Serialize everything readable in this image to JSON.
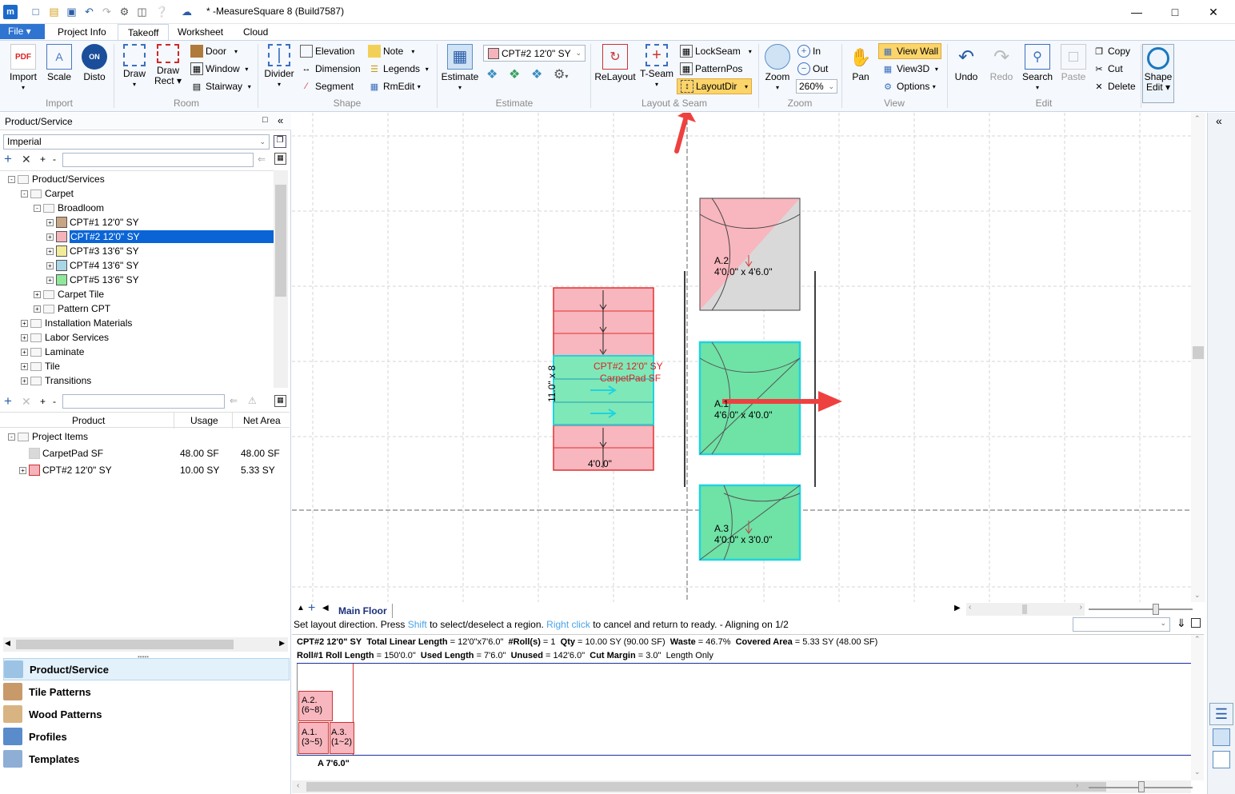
{
  "title_bar": {
    "title": "* -MeasureSquare 8 (Build7587)",
    "logo": "m"
  },
  "tabs": {
    "file": "File",
    "items": [
      "Project Info",
      "Takeoff",
      "Worksheet",
      "Cloud"
    ],
    "active": "Takeoff"
  },
  "ribbon": {
    "import_group": {
      "label": "Import",
      "buttons": [
        "Import",
        "Scale",
        "Disto"
      ]
    },
    "room_group": {
      "label": "Room",
      "draw": "Draw",
      "draw_rect_1": "Draw",
      "draw_rect_2": "Rect",
      "door": "Door",
      "window": "Window",
      "stairway": "Stairway"
    },
    "shape_group": {
      "label": "Shape",
      "divider": "Divider",
      "elevation": "Elevation",
      "dimension": "Dimension",
      "segment": "Segment",
      "note": "Note",
      "legends": "Legends",
      "rmedit": "RmEdit"
    },
    "estimate_group": {
      "label": "Estimate",
      "estimate": "Estimate",
      "product_select": "CPT#2 12'0\" SY"
    },
    "layout_group": {
      "label": "Layout & Seam",
      "relayout": "ReLayout",
      "tseam": "T-Seam",
      "lockseam": "LockSeam",
      "patternpos": "PatternPos",
      "layoutdir": "LayoutDir"
    },
    "zoom_group": {
      "label": "Zoom",
      "zoom": "Zoom",
      "in": "In",
      "out": "Out",
      "level": "260%"
    },
    "view_group": {
      "label": "View",
      "pan": "Pan",
      "view_wall": "View Wall",
      "view3d": "View3D",
      "options": "Options"
    },
    "edit_group": {
      "label": "Edit",
      "undo": "Undo",
      "redo": "Redo",
      "search": "Search",
      "paste": "Paste",
      "copy": "Copy",
      "cut": "Cut",
      "delete": "Delete"
    },
    "shape_edit": {
      "line1": "Shape",
      "line2": "Edit"
    }
  },
  "left_panel": {
    "title": "Product/Service",
    "unit_select": "Imperial",
    "tree": [
      {
        "label": "Product/Services",
        "level": 0,
        "exp": "-"
      },
      {
        "label": "Carpet",
        "level": 1,
        "exp": "-"
      },
      {
        "label": "Broadloom",
        "level": 2,
        "exp": "-"
      },
      {
        "label": "CPT#1 12'0\" SY",
        "level": 3,
        "exp": "+",
        "swatch": "#c8a582"
      },
      {
        "label": "CPT#2 12'0\" SY",
        "level": 3,
        "exp": "+",
        "swatch": "#f5b3bb",
        "selected": true
      },
      {
        "label": "CPT#3 13'6\" SY",
        "level": 3,
        "exp": "+",
        "swatch": "#f3eb9a"
      },
      {
        "label": "CPT#4 13'6\" SY",
        "level": 3,
        "exp": "+",
        "swatch": "#a8d6e6"
      },
      {
        "label": "CPT#5 13'6\" SY",
        "level": 3,
        "exp": "+",
        "swatch": "#8ee89a"
      },
      {
        "label": "Carpet Tile",
        "level": 2,
        "exp": "+"
      },
      {
        "label": "Pattern CPT",
        "level": 2,
        "exp": "+"
      },
      {
        "label": "Installation Materials",
        "level": 1,
        "exp": "+"
      },
      {
        "label": "Labor Services",
        "level": 1,
        "exp": "+"
      },
      {
        "label": "Laminate",
        "level": 1,
        "exp": "+"
      },
      {
        "label": "Tile",
        "level": 1,
        "exp": "+"
      },
      {
        "label": "Transitions",
        "level": 1,
        "exp": "+"
      }
    ],
    "table_headers": [
      "Product",
      "Usage",
      "Net Area"
    ],
    "project_items_label": "Project Items",
    "project_items": [
      {
        "product": "CarpetPad  SF",
        "usage": "48.00 SF",
        "net": "48.00 SF",
        "swatch": "#d9d9d9"
      },
      {
        "product": "CPT#2 12'0\" SY",
        "usage": "10.00 SY",
        "net": "5.33 SY",
        "swatch": "#f5b3bb"
      }
    ],
    "nav": [
      "Product/Service",
      "Tile Patterns",
      "Wood Patterns",
      "Profiles",
      "Templates"
    ]
  },
  "canvas": {
    "room_label_1": "CPT#2 12'0\" SY",
    "room_label_2": "CarpetPad  SF",
    "dim_vertical": "11.0\" x 8",
    "dim_bottom": "4'0.0\"",
    "piece_a2_id": "A.2",
    "piece_a2_size": "4'0.0\" x 4'6.0\"",
    "piece_a1_id": "A.1",
    "piece_a1_size": "4'6.0\" x 4'0.0\"",
    "piece_a3_id": "A.3",
    "piece_a3_size": "4'0.0\" x 3'0.0\""
  },
  "status": {
    "floor_tab": "Main Floor",
    "msg_1": "Set layout direction. Press ",
    "msg_shift": "Shift",
    "msg_2": " to select/deselect a region. ",
    "msg_right": "Right click",
    "msg_3": " to cancel and return to ready. - Aligning on 1/2"
  },
  "info": {
    "line1_name": "CPT#2 12'0\" SY",
    "line1_tll": "Total Linear Length",
    "line1_tll_val": " = 12'0\"x7'6.0\"",
    "line1_roll": "#Roll(s)",
    "line1_roll_val": " = 1",
    "line1_qty": "Qty",
    "line1_qty_val": " = 10.00 SY (90.00 SF)",
    "line1_waste": "Waste",
    "line1_waste_val": " = 46.7%",
    "line1_cov": "Covered Area",
    "line1_cov_val": " = 5.33 SY (48.00 SF)",
    "line2_roll": "Roll#1",
    "line2_rl": "Roll Length",
    "line2_rl_val": " = 150'0.0\"",
    "line2_ul": "Used Length",
    "line2_ul_val": " = 7'6.0\"",
    "line2_un": "Unused",
    "line2_un_val": " = 142'6.0\"",
    "line2_cm": "Cut Margin",
    "line2_cm_val": " = 3.0\"",
    "line2_lo": "Length Only",
    "roll_a2_1": "A.2.",
    "roll_a2_2": "(6~8)",
    "roll_a1_1": "A.1.",
    "roll_a1_2": "(3~5)",
    "roll_a3_1": "A.3.",
    "roll_a3_2": "(1~2)",
    "roll_total": "A 7'6.0\""
  }
}
